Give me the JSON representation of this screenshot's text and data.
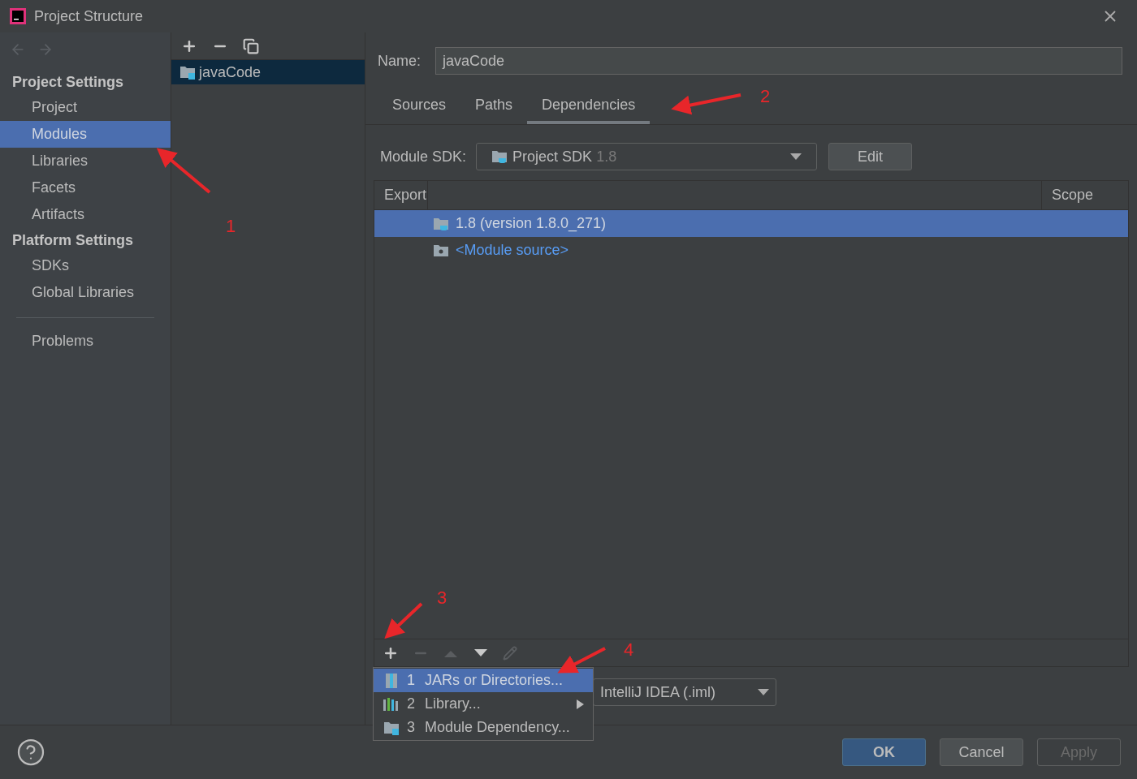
{
  "window": {
    "title": "Project Structure"
  },
  "sidebar": {
    "sections": [
      {
        "heading": "Project Settings",
        "items": [
          {
            "label": "Project",
            "selected": false
          },
          {
            "label": "Modules",
            "selected": true
          },
          {
            "label": "Libraries",
            "selected": false
          },
          {
            "label": "Facets",
            "selected": false
          },
          {
            "label": "Artifacts",
            "selected": false
          }
        ]
      },
      {
        "heading": "Platform Settings",
        "items": [
          {
            "label": "SDKs",
            "selected": false
          },
          {
            "label": "Global Libraries",
            "selected": false
          }
        ]
      }
    ],
    "footer_items": [
      {
        "label": "Problems",
        "selected": false
      }
    ]
  },
  "modules": [
    {
      "name": "javaCode",
      "selected": true
    }
  ],
  "name_field": {
    "label": "Name:",
    "value": "javaCode"
  },
  "tabs": [
    {
      "label": "Sources",
      "selected": false
    },
    {
      "label": "Paths",
      "selected": false
    },
    {
      "label": "Dependencies",
      "selected": true
    }
  ],
  "module_sdk": {
    "label": "Module SDK:",
    "value": "Project SDK",
    "version": "1.8",
    "edit_button": "Edit"
  },
  "dependencies": {
    "columns": [
      "Export",
      "Scope"
    ],
    "rows": [
      {
        "label": "1.8 (version 1.8.0_271)",
        "kind": "sdk",
        "selected": true
      },
      {
        "label": "<Module source>",
        "kind": "source",
        "selected": false
      }
    ],
    "toolbar": [
      {
        "kind": "add",
        "disabled": false
      },
      {
        "kind": "remove",
        "disabled": true
      },
      {
        "kind": "up",
        "disabled": true
      },
      {
        "kind": "down",
        "disabled": false
      },
      {
        "kind": "edit",
        "disabled": true
      }
    ]
  },
  "storage_format": {
    "value": "IntelliJ IDEA (.iml)"
  },
  "popup_menu": [
    {
      "number": "1",
      "label": "JARs or Directories...",
      "kind": "jars",
      "selected": true,
      "submenu": false
    },
    {
      "number": "2",
      "label": "Library...",
      "kind": "library",
      "selected": false,
      "submenu": true
    },
    {
      "number": "3",
      "label": "Module Dependency...",
      "kind": "module",
      "selected": false,
      "submenu": false
    }
  ],
  "buttons": [
    {
      "label": "OK",
      "kind": "primary",
      "disabled": false
    },
    {
      "label": "Cancel",
      "kind": "normal",
      "disabled": false
    },
    {
      "label": "Apply",
      "kind": "normal",
      "disabled": true
    }
  ],
  "annotations": [
    {
      "label": "1"
    },
    {
      "label": "2"
    },
    {
      "label": "3"
    },
    {
      "label": "4"
    }
  ]
}
